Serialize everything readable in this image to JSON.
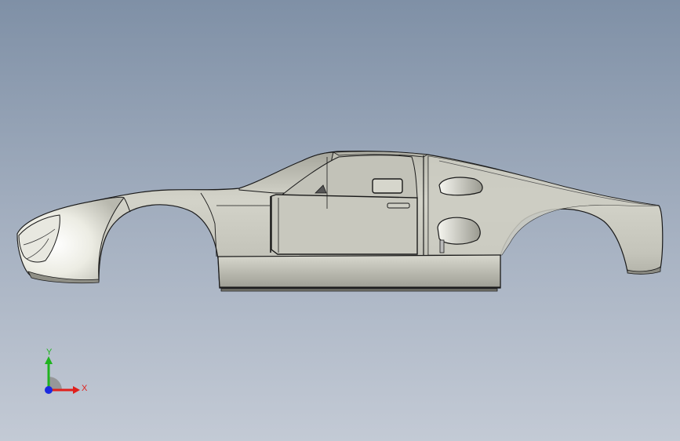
{
  "viewport": {
    "background_top": "#7f90a6",
    "background_bottom": "#c3cad5"
  },
  "model": {
    "body_color": "#c9c9bf",
    "highlight_color": "#f4f4ee",
    "shadow_color": "#8e8e85",
    "edge_color": "#1a1a1a"
  },
  "triad": {
    "x_label": "X",
    "y_label": "Y",
    "x_color": "#e0201c",
    "y_color": "#1fb31f",
    "z_color": "#1a2ae0"
  }
}
